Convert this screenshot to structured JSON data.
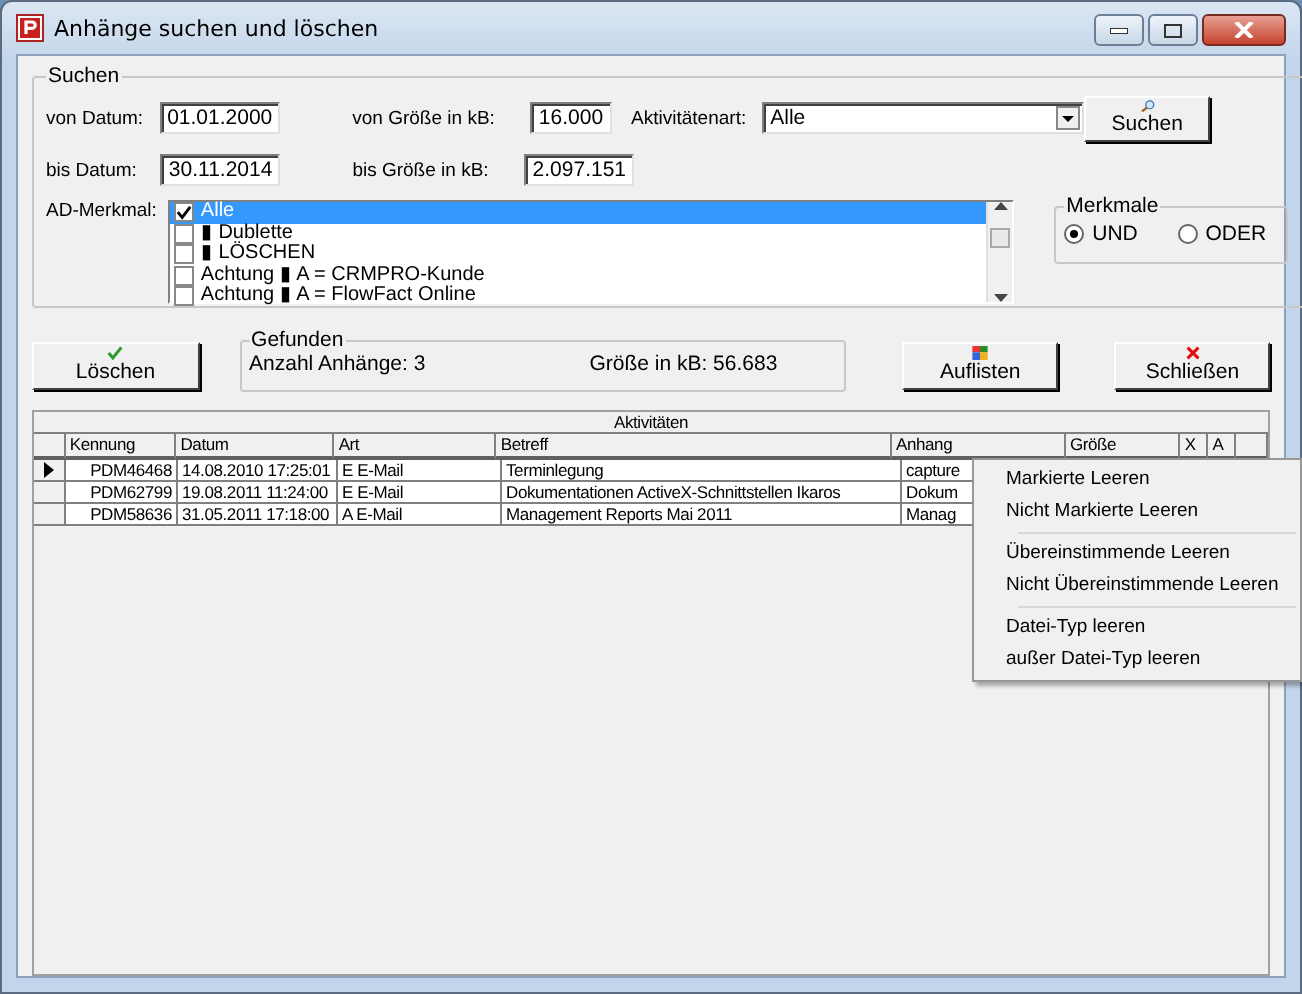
{
  "window": {
    "title": "Anhänge suchen und löschen"
  },
  "search": {
    "legend": "Suchen",
    "from_date": {
      "label": "von Datum:",
      "value": "01.01.2000"
    },
    "to_date": {
      "label": "bis Datum:",
      "value": "30.11.2014"
    },
    "from_size": {
      "label": "von Größe in kB:",
      "value": "16.000"
    },
    "to_size": {
      "label": "bis Größe in kB:",
      "value": "2.097.151"
    },
    "activity_type": {
      "label": "Aktivitätenart:",
      "value": "Alle"
    },
    "search_button": "Suchen",
    "ad_label": "AD-Merkmal:",
    "ad_items": [
      {
        "label": "Alle",
        "checked": true,
        "selected": true
      },
      {
        "label": "▮ Dublette",
        "checked": false,
        "selected": false
      },
      {
        "label": "▮ LÖSCHEN",
        "checked": false,
        "selected": false
      },
      {
        "label": "Achtung ▮ A = CRMPRO-Kunde",
        "checked": false,
        "selected": false
      },
      {
        "label": "Achtung ▮ A = FlowFact Online",
        "checked": false,
        "selected": false
      }
    ],
    "merkmale": {
      "legend": "Merkmale",
      "options": [
        {
          "label": "UND",
          "selected": true
        },
        {
          "label": "ODER",
          "selected": false
        }
      ]
    }
  },
  "delete_button": "Löschen",
  "found": {
    "legend": "Gefunden",
    "count": "Anzahl Anhänge: 3",
    "size": "Größe in kB: 56.683"
  },
  "list_button": "Auflisten",
  "close_button": "Schließen",
  "table": {
    "title": "Aktivitäten",
    "columns": [
      "Kennung",
      "Datum",
      "Art",
      "Betreff",
      "Anhang",
      "Größe",
      "X",
      "A"
    ],
    "rows": [
      {
        "selected": true,
        "cells": [
          "PDM46468",
          "14.08.2010 17:25:01",
          "E   E-Mail",
          "Terminlegung",
          "capture",
          "",
          "",
          ""
        ]
      },
      {
        "selected": false,
        "cells": [
          "PDM62799",
          "19.08.2011 11:24:00",
          "E   E-Mail",
          "Dokumentationen ActiveX-Schnittstellen Ikaros",
          "Dokum",
          "",
          "",
          ""
        ]
      },
      {
        "selected": false,
        "cells": [
          "PDM58636",
          "31.05.2011 17:18:00",
          "A   E-Mail",
          "Management Reports Mai 2011",
          "Manag",
          "",
          "",
          ""
        ]
      }
    ]
  },
  "context_menu": {
    "groups": [
      [
        "Markierte Leeren",
        "Nicht Markierte Leeren"
      ],
      [
        "Übereinstimmende Leeren",
        "Nicht Übereinstimmende Leeren"
      ],
      [
        "Datei-Typ leeren",
        "außer Datei-Typ leeren"
      ]
    ]
  }
}
